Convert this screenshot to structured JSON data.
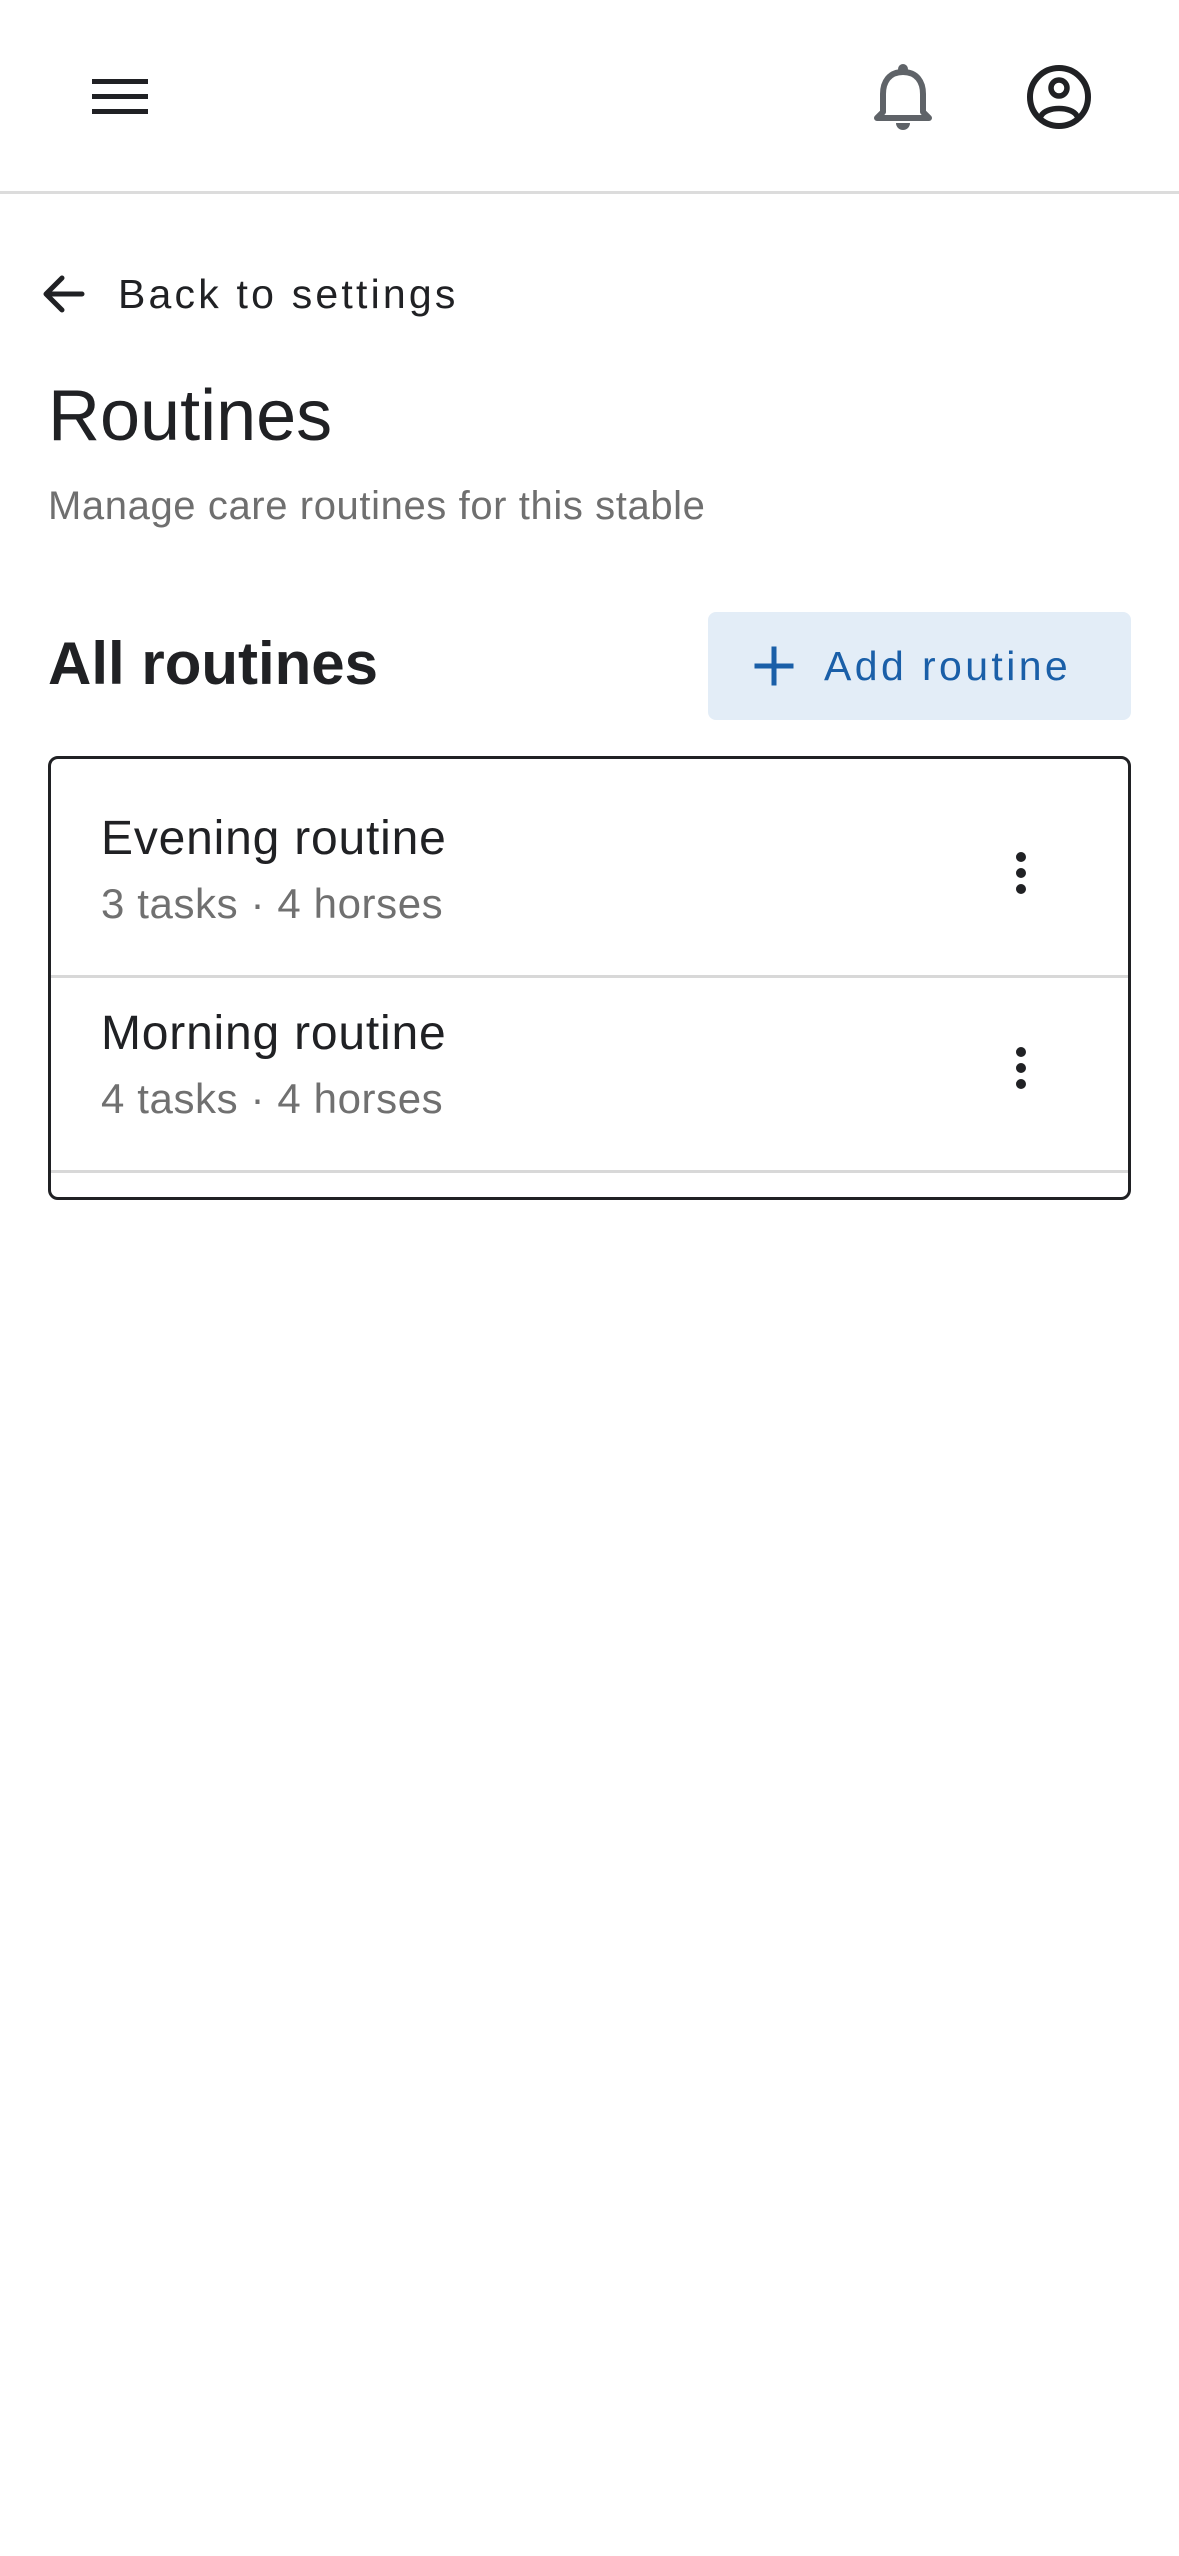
{
  "header": {
    "menu_icon": "hamburger-menu-icon",
    "notifications_icon": "bell-icon",
    "account_icon": "account-circle-icon"
  },
  "back_link": {
    "icon": "arrow-left-icon",
    "label": "Back to settings"
  },
  "page": {
    "title": "Routines",
    "subtitle": "Manage care routines for this stable"
  },
  "section": {
    "title": "All routines",
    "add_button": {
      "icon": "plus-icon",
      "label": "Add routine"
    }
  },
  "routines": [
    {
      "name": "Evening routine",
      "meta": "3 tasks · 4 horses",
      "more_icon": "more-vertical-icon"
    },
    {
      "name": "Morning routine",
      "meta": "4 tasks · 4 horses",
      "more_icon": "more-vertical-icon"
    }
  ],
  "colors": {
    "accent_text": "#1a5fa8",
    "accent_bg": "#e3edf7",
    "text_primary": "#202124",
    "text_secondary": "#707070",
    "divider": "#d8d8d8"
  }
}
